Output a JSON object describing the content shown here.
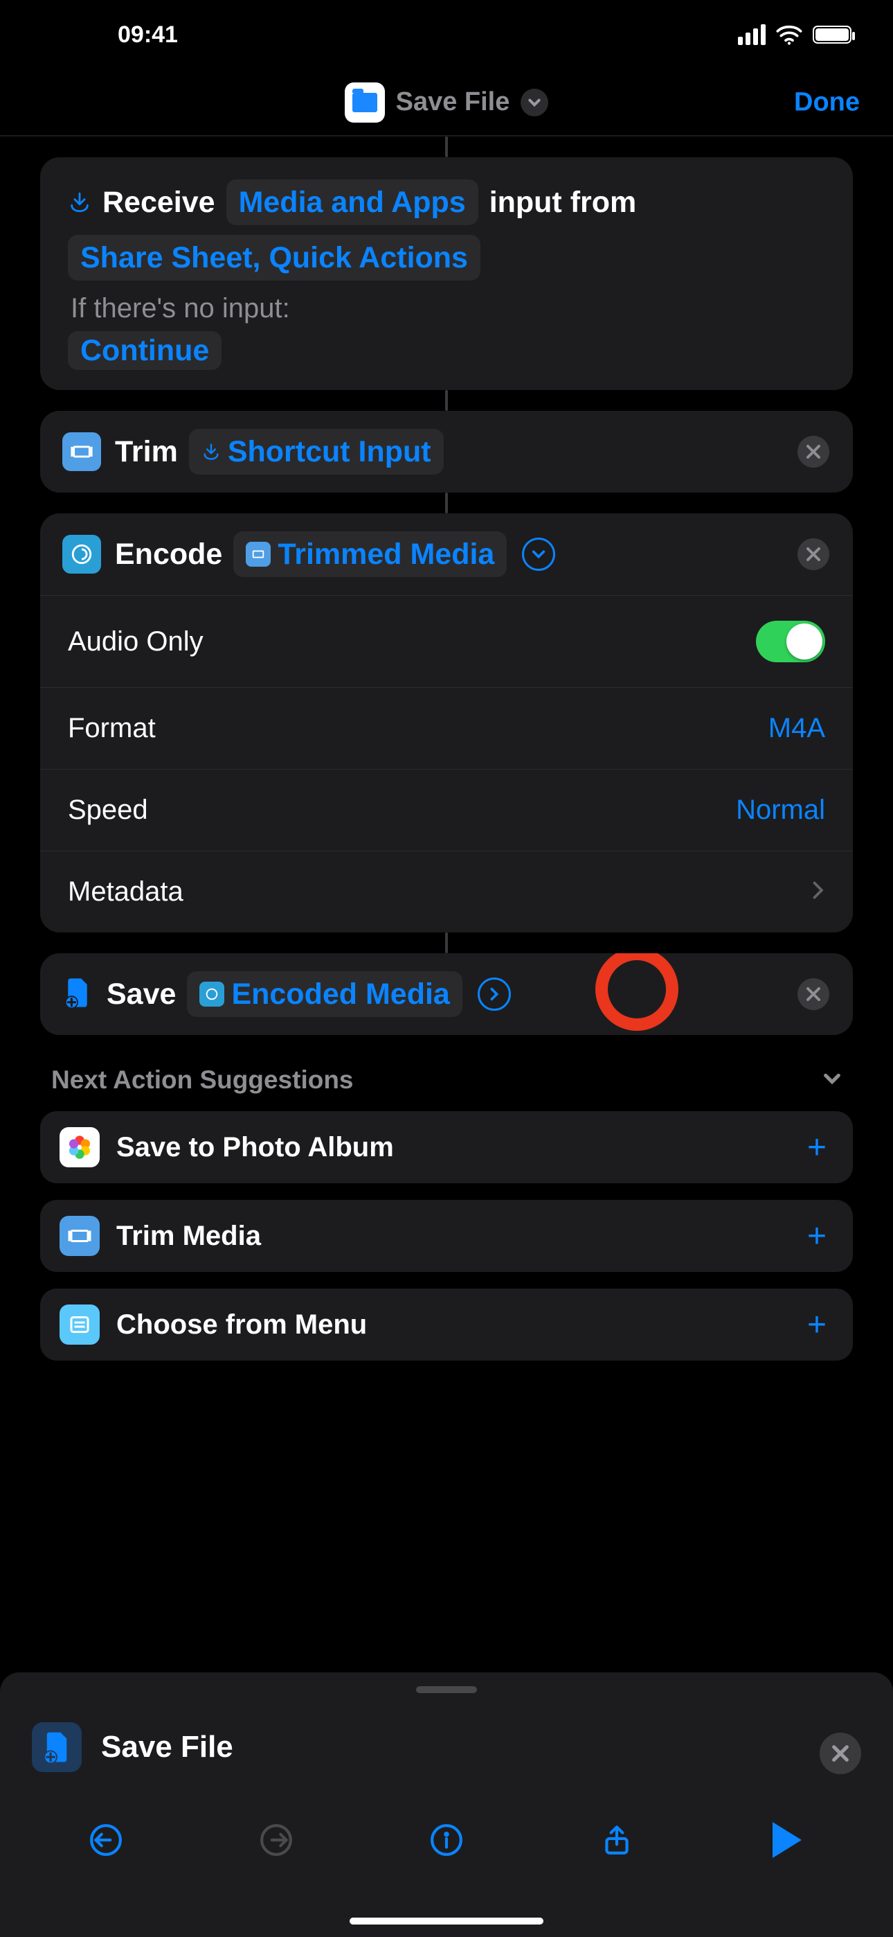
{
  "status": {
    "time": "09:41"
  },
  "nav": {
    "title": "Save File",
    "done": "Done"
  },
  "receive": {
    "word1": "Receive",
    "token1": "Media and Apps",
    "word2": "input from",
    "token2": "Share Sheet, Quick Actions",
    "noInput": "If there's no input:",
    "fallback": "Continue"
  },
  "trim": {
    "label": "Trim",
    "token": "Shortcut Input"
  },
  "encode": {
    "label": "Encode",
    "token": "Trimmed Media",
    "rows": {
      "audioOnly": "Audio Only",
      "format": {
        "label": "Format",
        "value": "M4A"
      },
      "speed": {
        "label": "Speed",
        "value": "Normal"
      },
      "metadata": "Metadata"
    }
  },
  "save": {
    "label": "Save",
    "token": "Encoded Media"
  },
  "suggestions": {
    "header": "Next Action Suggestions",
    "items": [
      {
        "label": "Save to Photo Album"
      },
      {
        "label": "Trim Media"
      },
      {
        "label": "Choose from Menu"
      }
    ]
  },
  "sheet": {
    "title": "Save File"
  }
}
